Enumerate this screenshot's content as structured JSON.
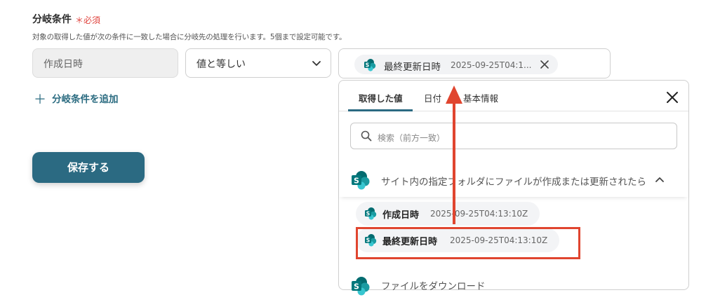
{
  "section": {
    "title": "分岐条件",
    "required": "＊必須",
    "description": "対象の取得した値が次の条件に一致した場合に分岐先の処理を行います。5個まで設定可能です。"
  },
  "condition": {
    "field": "作成日時",
    "operator": "値と等しい",
    "value_chip": {
      "name": "最終更新日時",
      "value": "2025-09-25T04:1..."
    }
  },
  "add_condition_label": "分岐条件を追加",
  "save_label": "保存する",
  "dropdown": {
    "tabs": [
      {
        "label": "取得した値",
        "active": true
      },
      {
        "label": "日付",
        "active": false
      },
      {
        "label": "基本情報",
        "active": false
      }
    ],
    "search_placeholder": "検索（前方一致）",
    "group": {
      "label": "サイト内の指定フォルダにファイルが作成または更新されたら",
      "expanded": true,
      "items": [
        {
          "name": "作成日時",
          "value": "2025-09-25T04:13:10Z"
        },
        {
          "name": "最終更新日時",
          "value": "2025-09-25T04:13:10Z",
          "highlighted": true
        }
      ]
    },
    "next_group_label": "ファイルをダウンロード"
  },
  "colors": {
    "accent": "#2b6a82",
    "required": "#e0443e",
    "annotation": "#e0452f",
    "sharepoint_dark": "#036c70",
    "sharepoint_mid": "#1a9ba1",
    "sharepoint_light": "#37c6d0"
  },
  "icons": [
    "sharepoint-icon",
    "chevron-down-icon",
    "close-icon",
    "search-icon",
    "chevron-up-icon",
    "plus-icon"
  ]
}
